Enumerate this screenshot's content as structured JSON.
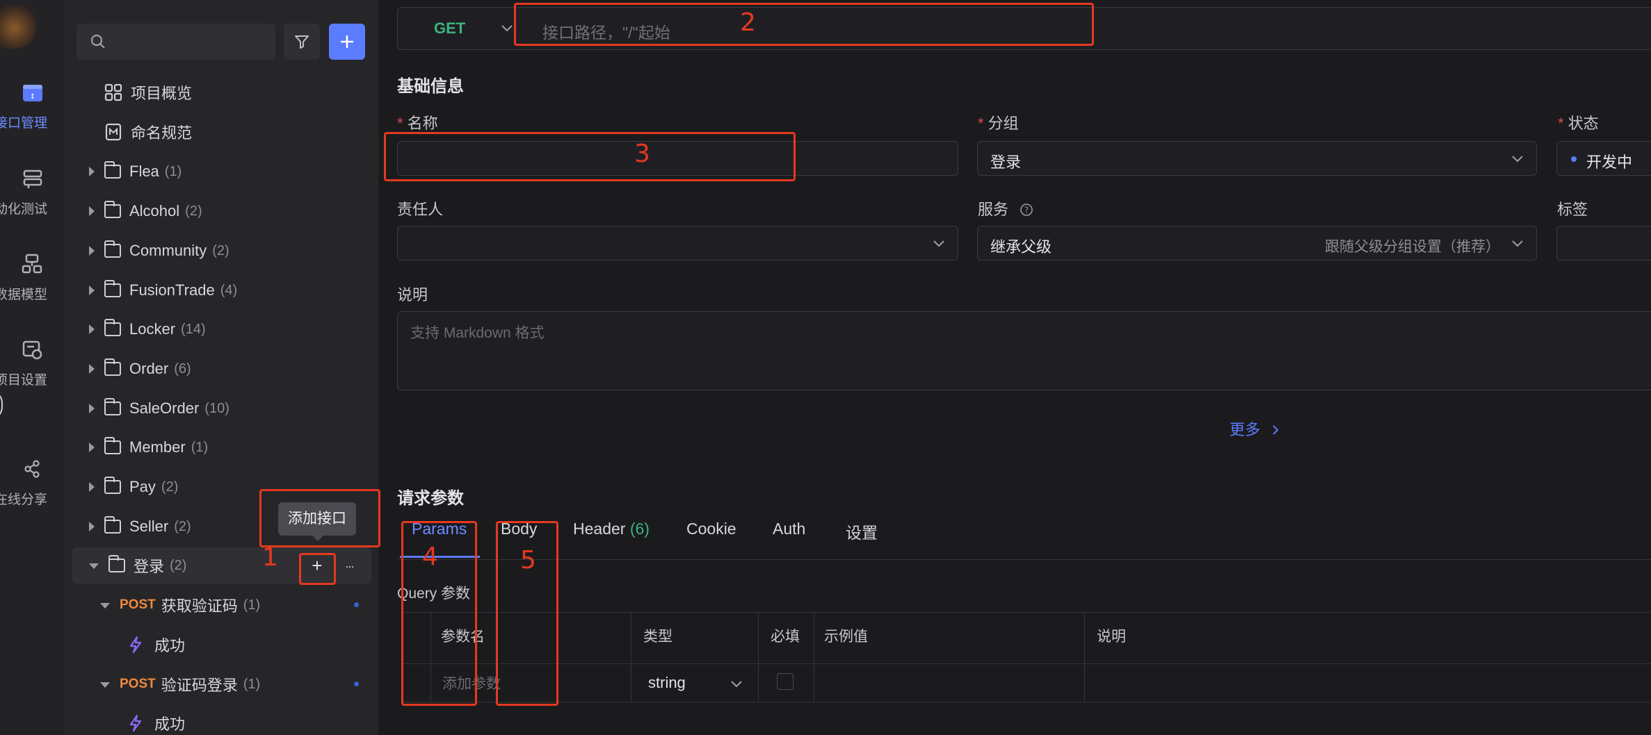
{
  "rail": {
    "items": [
      {
        "label": "接口管理",
        "active": true
      },
      {
        "label": "动化测试"
      },
      {
        "label": "数据模型"
      },
      {
        "label": "项目设置"
      },
      {
        "label": "在线分享"
      }
    ]
  },
  "sidebar": {
    "search_placeholder": "",
    "items": [
      {
        "type": "page",
        "label": "项目概览"
      },
      {
        "type": "page",
        "label": "命名规范"
      },
      {
        "type": "folder",
        "label": "Flea",
        "count": "(1)"
      },
      {
        "type": "folder",
        "label": "Alcohol",
        "count": "(2)"
      },
      {
        "type": "folder",
        "label": "Community",
        "count": "(2)"
      },
      {
        "type": "folder",
        "label": "FusionTrade",
        "count": "(4)"
      },
      {
        "type": "folder",
        "label": "Locker",
        "count": "(14)"
      },
      {
        "type": "folder",
        "label": "Order",
        "count": "(6)"
      },
      {
        "type": "folder",
        "label": "SaleOrder",
        "count": "(10)"
      },
      {
        "type": "folder",
        "label": "Member",
        "count": "(1)"
      },
      {
        "type": "folder",
        "label": "Pay",
        "count": "(2)"
      },
      {
        "type": "folder",
        "label": "Seller",
        "count": "(2)"
      },
      {
        "type": "folder-open",
        "label": "登录",
        "count": "(2)"
      },
      {
        "type": "api",
        "method": "POST",
        "label": "获取验证码",
        "count": "(1)"
      },
      {
        "type": "case",
        "label": "成功"
      },
      {
        "type": "api",
        "method": "POST",
        "label": "验证码登录",
        "count": "(1)"
      },
      {
        "type": "case",
        "label": "成功"
      }
    ],
    "tooltip": "添加接口",
    "add_symbol": "+",
    "more_symbol": "···"
  },
  "request": {
    "method": "GET",
    "path_placeholder": "接口路径，\"/\"起始"
  },
  "basic": {
    "heading": "基础信息",
    "name_label": "名称",
    "name_value": "",
    "group_label": "分组",
    "group_value": "登录",
    "status_label": "状态",
    "status_value": "开发中",
    "owner_label": "责任人",
    "service_label": "服务",
    "service_value": "继承父级",
    "service_hint": "跟随父级分组设置（推荐）",
    "tags_label": "标签",
    "desc_label": "说明",
    "desc_placeholder": "支持 Markdown 格式",
    "more_link": "更多"
  },
  "params": {
    "heading": "请求参数",
    "tabs": [
      {
        "label": "Params"
      },
      {
        "label": "Body"
      },
      {
        "label": "Header",
        "count": "(6)"
      },
      {
        "label": "Cookie"
      },
      {
        "label": "Auth"
      },
      {
        "label": "设置"
      }
    ],
    "query_label": "Query 参数",
    "columns": [
      "参数名",
      "类型",
      "必填",
      "示例值",
      "说明"
    ],
    "row": {
      "name_placeholder": "添加参数",
      "type": "string"
    }
  },
  "annotations": [
    "1",
    "2",
    "3",
    "4",
    "5"
  ],
  "colors": {
    "accent": "#5b7cff",
    "get": "#3fb27f",
    "post": "#f0883e",
    "annotation": "#e5391f"
  }
}
